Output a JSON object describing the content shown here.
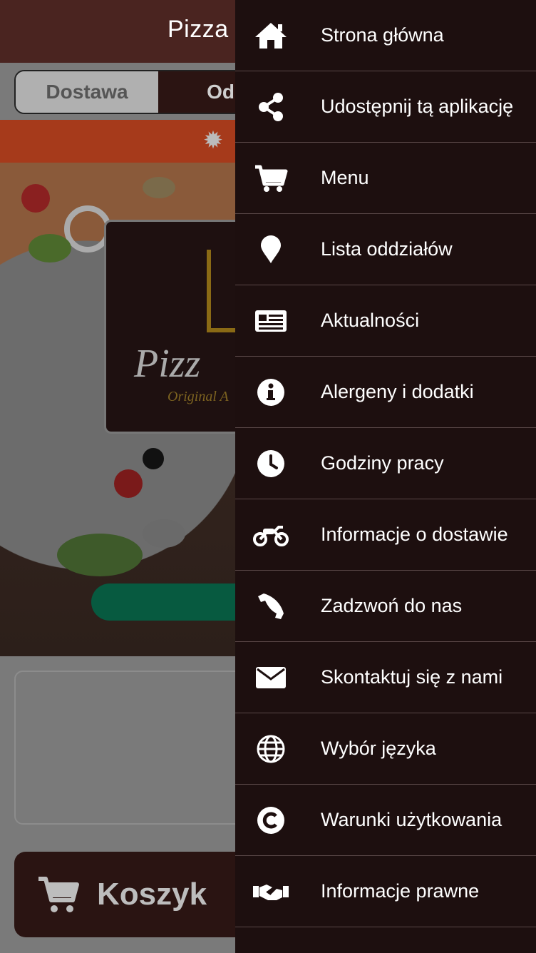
{
  "header": {
    "title": "Pizza K"
  },
  "order_type": {
    "delivery_label": "Dostawa",
    "pickup_label": "Odbi"
  },
  "hero": {
    "logo_text": "Pizz",
    "logo_subtitle": "Original A"
  },
  "cart": {
    "label": "Koszyk"
  },
  "drawer": {
    "items": [
      {
        "label": "Strona główna",
        "icon": "home-icon"
      },
      {
        "label": "Udostępnij tą aplikację",
        "icon": "share-icon"
      },
      {
        "label": "Menu",
        "icon": "cart-icon"
      },
      {
        "label": "Lista oddziałów",
        "icon": "map-pin-icon"
      },
      {
        "label": "Aktualności",
        "icon": "newspaper-icon"
      },
      {
        "label": "Alergeny i dodatki",
        "icon": "info-icon"
      },
      {
        "label": "Godziny pracy",
        "icon": "clock-icon"
      },
      {
        "label": "Informacje o dostawie",
        "icon": "motorcycle-icon"
      },
      {
        "label": "Zadzwoń do nas",
        "icon": "phone-icon"
      },
      {
        "label": "Skontaktuj się z nami",
        "icon": "envelope-icon"
      },
      {
        "label": "Wybór języka",
        "icon": "globe-icon"
      },
      {
        "label": "Warunki użytkowania",
        "icon": "copyright-icon"
      },
      {
        "label": "Informacje prawne",
        "icon": "handshake-icon"
      }
    ]
  },
  "colors": {
    "drawer_bg": "#1d0f0f",
    "header_bg": "#4a2420",
    "promo_bar": "#a63a1b",
    "green_button": "#075a40"
  }
}
